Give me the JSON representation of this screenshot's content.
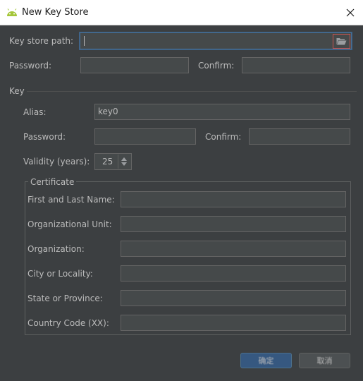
{
  "window": {
    "title": "New Key Store",
    "icon": "android-icon",
    "close_icon": "close-icon"
  },
  "keystore": {
    "path_label": "Key store path:",
    "path_value": "",
    "browse_icon": "folder-open-icon",
    "password_label": "Password:",
    "confirm_label": "Confirm:"
  },
  "key": {
    "section_label": "Key",
    "alias_label": "Alias:",
    "alias_value": "key0",
    "password_label": "Password:",
    "confirm_label": "Confirm:",
    "validity_label": "Validity (years):",
    "validity_value": "25"
  },
  "certificate": {
    "title": "Certificate",
    "fields": [
      {
        "label": "First and Last Name:",
        "value": ""
      },
      {
        "label": "Organizational Unit:",
        "value": ""
      },
      {
        "label": "Organization:",
        "value": ""
      },
      {
        "label": "City or Locality:",
        "value": ""
      },
      {
        "label": "State or Province:",
        "value": ""
      },
      {
        "label": "Country Code (XX):",
        "value": ""
      }
    ]
  },
  "buttons": {
    "ok_label": "确定",
    "cancel_label": "取消"
  },
  "colors": {
    "background": "#3c3f41",
    "field": "#45494a",
    "focus_border": "#466d94",
    "ok_button": "#365880",
    "browse_highlight": "#c75450"
  }
}
